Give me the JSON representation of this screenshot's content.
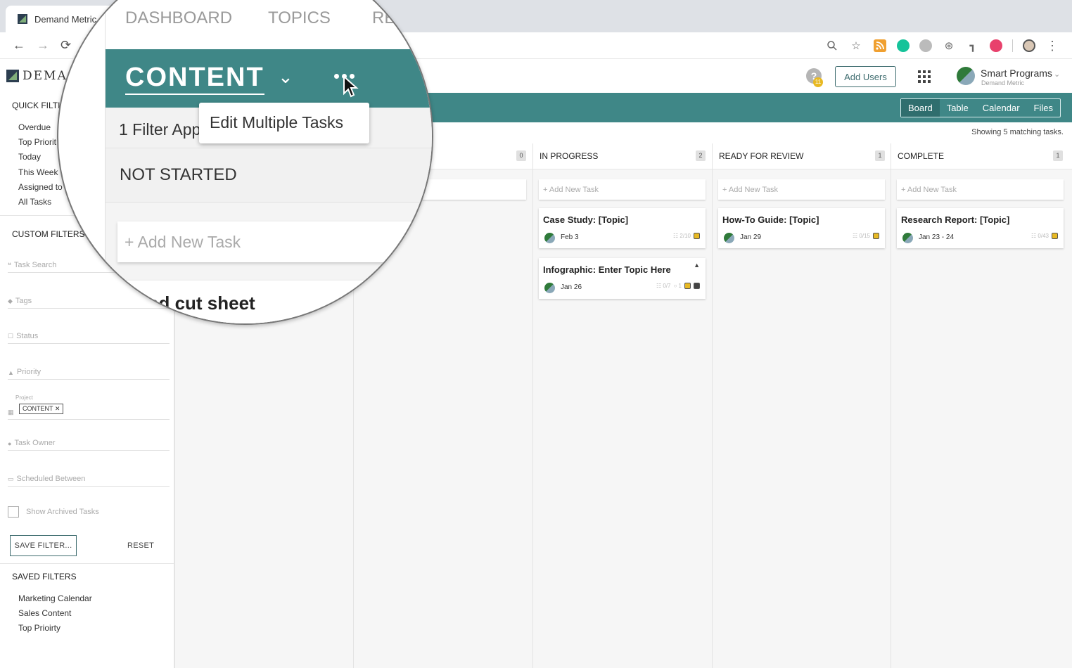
{
  "browser": {
    "tab_title": "Demand Metric",
    "nav": {
      "back": "←",
      "forward": "→",
      "reload": "⟳"
    },
    "icons": [
      "zoom-icon",
      "star-icon",
      "rss-icon",
      "grammarly-icon",
      "extension-t-icon",
      "extension-chatgpt-icon",
      "extension-pin-icon",
      "extension-red-icon",
      "profile-icon",
      "menu-dots-icon"
    ]
  },
  "app": {
    "logo_text": "DEMA",
    "help_badge": "11",
    "add_users": "Add Users",
    "account_name": "Smart Programs",
    "account_org": "Demand Metric"
  },
  "views": [
    "Board",
    "Table",
    "Calendar",
    "Files"
  ],
  "active_view": "Board",
  "showing_text": "Showing 5 matching tasks.",
  "sidebar": {
    "quick_filters_title": "QUICK FILTI",
    "quick_filters": [
      "Overdue",
      "Top Priorit",
      "Today",
      "This Week",
      "Assigned to",
      "All Tasks"
    ],
    "custom_filters_title": "CUSTOM FILTERS",
    "fields": {
      "task_search": "Task Search",
      "tags": "Tags",
      "status": "Status",
      "priority": "Priority",
      "project_label": "Project",
      "project_chip": "CONTENT ✕",
      "task_owner": "Task Owner",
      "scheduled": "Scheduled Between"
    },
    "show_archived": "Show Archived Tasks",
    "save_filter": "SAVE FILTER...",
    "reset": "RESET",
    "saved_filters_title": "SAVED FILTERS",
    "saved_filters": [
      "Marketing Calendar",
      "Sales Content",
      "Top Prioirty"
    ]
  },
  "board": {
    "columns": [
      {
        "title": "",
        "count": ""
      },
      {
        "title": "",
        "count": "0"
      },
      {
        "title": "IN PROGRESS",
        "count": "2"
      },
      {
        "title": "READY FOR REVIEW",
        "count": "1"
      },
      {
        "title": "COMPLETE",
        "count": "1"
      }
    ],
    "add_task": "+ Add New Task",
    "cards": {
      "in_progress": [
        {
          "title": "Case Study: [Topic]",
          "date": "Feb 3",
          "checklist": "☷ 2/10"
        },
        {
          "title": "Infographic: Enter Topic Here",
          "date": "Jan 26",
          "checklist": "☷ 0/7",
          "comments": "○ 1"
        }
      ],
      "ready_for_review": [
        {
          "title": "How-To Guide: [Topic]",
          "date": "Jan 29",
          "checklist": "☷ 0/15"
        }
      ],
      "complete": [
        {
          "title": "Research Report: [Topic]",
          "date": "Jan 23 - 24",
          "checklist": "☷ 0/43"
        }
      ]
    }
  },
  "magnifier": {
    "tabs": [
      "DASHBOARD",
      "TOPICS",
      "RE"
    ],
    "project_name": "CONTENT",
    "filter_text": "1 Filter App",
    "tooltip": "Edit Multiple Tasks",
    "column_title": "NOT STARTED",
    "add_task": "+ Add New Task",
    "card_peek": "ed cut sheet"
  }
}
